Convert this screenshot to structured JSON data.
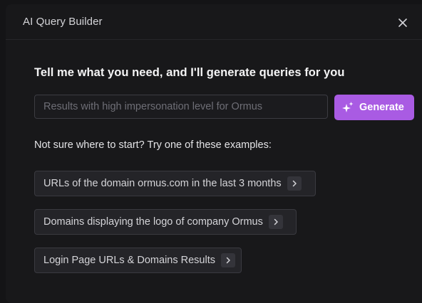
{
  "dialog": {
    "title": "AI Query Builder"
  },
  "prompt": {
    "heading": "Tell me what you need, and I'll generate queries for you",
    "input_placeholder": "Results with high impersonation level for Ormus",
    "input_value": "",
    "generate_label": "Generate"
  },
  "examples": {
    "intro": "Not sure where to start? Try one of these examples:",
    "items": [
      {
        "label": "URLs of the domain ormus.com in the last 3 months"
      },
      {
        "label": "Domains displaying the logo of company Ormus"
      },
      {
        "label": "Login Page URLs & Domains Results"
      }
    ]
  },
  "colors": {
    "background": "#18181a",
    "accent": "#a95be3",
    "chip_background": "#242428"
  },
  "icons": {
    "close": "close-icon",
    "generate": "sparkle-icon",
    "example_arrow": "chevron-right-icon"
  }
}
